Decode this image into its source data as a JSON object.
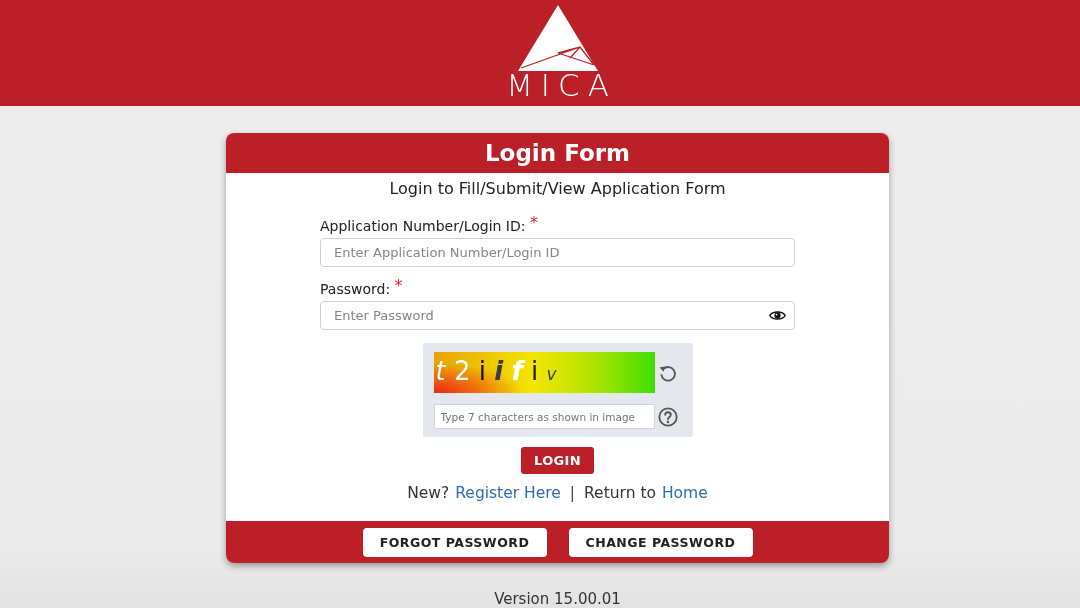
{
  "header": {
    "logo_text": "MICA"
  },
  "login_form": {
    "title": "Login Form",
    "subtitle": "Login to Fill/Submit/View Application Form",
    "fields": [
      {
        "kind": "text",
        "label": "Application Number/Login ID:",
        "required_mark": "*",
        "placeholder": "Enter Application Number/Login ID"
      },
      {
        "kind": "password",
        "label": "Password:",
        "required_mark": "*",
        "placeholder": "Enter Password"
      }
    ],
    "captcha": {
      "image_text": "t 2 i i f i v",
      "placeholder": "Type 7 characters as shown in image"
    },
    "login_button": "LOGIN",
    "links_line": [
      {
        "kind": "text",
        "text": "New?"
      },
      {
        "kind": "link",
        "text": "Register Here"
      },
      {
        "kind": "separator",
        "text": "|"
      },
      {
        "kind": "text",
        "text": "Return to"
      },
      {
        "kind": "link",
        "text": "Home"
      }
    ],
    "footer_buttons": [
      "FORGOT PASSWORD",
      "CHANGE PASSWORD"
    ]
  },
  "version": "Version 15.00.01"
}
